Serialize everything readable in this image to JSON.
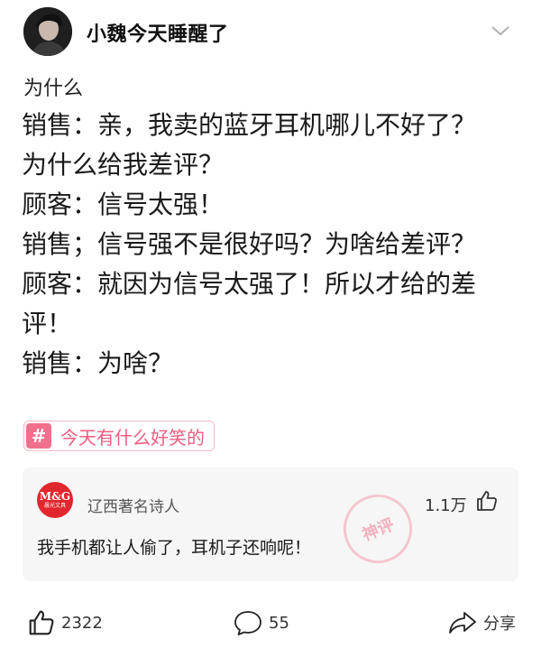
{
  "user": {
    "name": "小魏今天睡醒了"
  },
  "post": {
    "title": "为什么",
    "lines": [
      "销售：亲，我卖的蓝牙耳机哪儿不好了？",
      "为什么给我差评？",
      "顾客：信号太强！",
      "销售；信号强不是很好吗？为啥给差评？",
      "顾客：就因为信号太强了！所以才给的差",
      "评！",
      "销售：为啥？"
    ]
  },
  "topic": {
    "hash": "#",
    "label": "今天有什么好笑的"
  },
  "top_comment": {
    "avatar_logo": "M&G",
    "avatar_sub": "晨光文具",
    "author": "辽西著名诗人",
    "likes": "1.1万",
    "text": "我手机都让人偷了，耳机子还响呢！",
    "stamp": "神评"
  },
  "actions": {
    "likes": "2322",
    "comments": "55",
    "share": "分享"
  },
  "icons": [
    "chevron-down-icon",
    "thumbs-up-icon",
    "comment-bubble-icon",
    "share-arrow-icon"
  ]
}
